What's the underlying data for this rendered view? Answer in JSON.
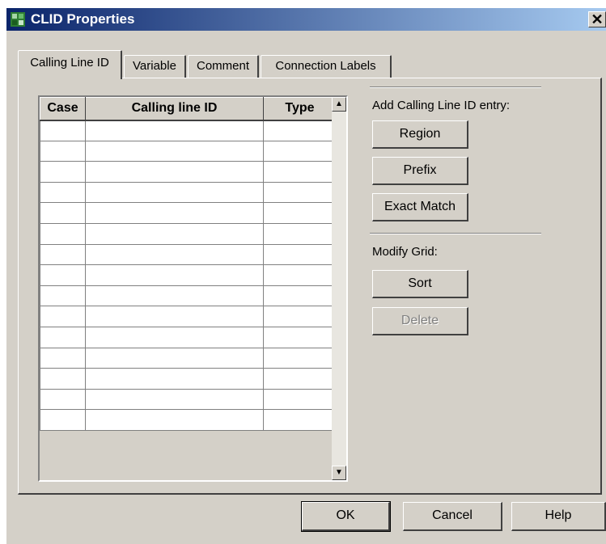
{
  "window": {
    "title": "CLID Properties",
    "close_glyph": "✕"
  },
  "tabs": [
    {
      "label": "Calling Line ID",
      "active": true
    },
    {
      "label": "Variable",
      "active": false
    },
    {
      "label": "Comment",
      "active": false
    },
    {
      "label": "Connection Labels",
      "active": false
    }
  ],
  "grid": {
    "columns": [
      "Case",
      "Calling line ID",
      "Type"
    ],
    "rows": [
      [
        "",
        "",
        ""
      ],
      [
        "",
        "",
        ""
      ],
      [
        "",
        "",
        ""
      ],
      [
        "",
        "",
        ""
      ],
      [
        "",
        "",
        ""
      ],
      [
        "",
        "",
        ""
      ],
      [
        "",
        "",
        ""
      ],
      [
        "",
        "",
        ""
      ],
      [
        "",
        "",
        ""
      ],
      [
        "",
        "",
        ""
      ],
      [
        "",
        "",
        ""
      ],
      [
        "",
        "",
        ""
      ],
      [
        "",
        "",
        ""
      ],
      [
        "",
        "",
        ""
      ],
      [
        "",
        "",
        ""
      ]
    ],
    "scroll_up_glyph": "▲",
    "scroll_down_glyph": "▼"
  },
  "add_section": {
    "label": "Add Calling Line ID entry:",
    "region": "Region",
    "prefix": "Prefix",
    "exact_match": "Exact Match"
  },
  "modify_section": {
    "label": "Modify Grid:",
    "sort": "Sort",
    "delete": "Delete"
  },
  "footer": {
    "ok": "OK",
    "cancel": "Cancel",
    "help": "Help"
  }
}
